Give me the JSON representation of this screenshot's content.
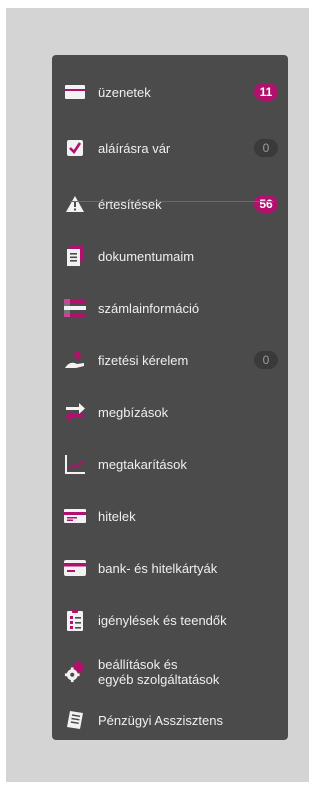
{
  "colors": {
    "accent": "#b0116c",
    "panel": "#4b4b4b",
    "frame": "#d4d4d4",
    "text": "#efefef"
  },
  "menu": {
    "items": [
      {
        "label": "üzenetek",
        "icon": "envelope-icon",
        "badge": "11",
        "badge_style": "pink"
      },
      {
        "label": "aláírásra vár",
        "icon": "signature-check-icon",
        "badge": "0",
        "badge_style": "grey"
      },
      {
        "label": "értesítések",
        "icon": "warning-icon",
        "badge": "56",
        "badge_style": "pink"
      },
      {
        "label": "dokumentumaim",
        "icon": "documents-icon"
      },
      {
        "label": "számlainformáció",
        "icon": "account-info-icon"
      },
      {
        "label": "fizetési kérelem",
        "icon": "payment-request-icon",
        "badge": "0",
        "badge_style": "grey"
      },
      {
        "label": "megbízások",
        "icon": "transfer-arrows-icon"
      },
      {
        "label": "megtakarítások",
        "icon": "savings-chart-icon"
      },
      {
        "label": "hitelek",
        "icon": "loan-icon"
      },
      {
        "label": "bank- és hitelkártyák",
        "icon": "credit-card-icon"
      },
      {
        "label": "igénylések és teendők",
        "icon": "checklist-icon"
      },
      {
        "label_line1": "beállítások és",
        "label_line2": "egyéb szolgáltatások",
        "icon": "settings-gear-icon"
      },
      {
        "label": "Pénzügyi Asszisztens",
        "icon": "assistant-book-icon"
      }
    ]
  }
}
